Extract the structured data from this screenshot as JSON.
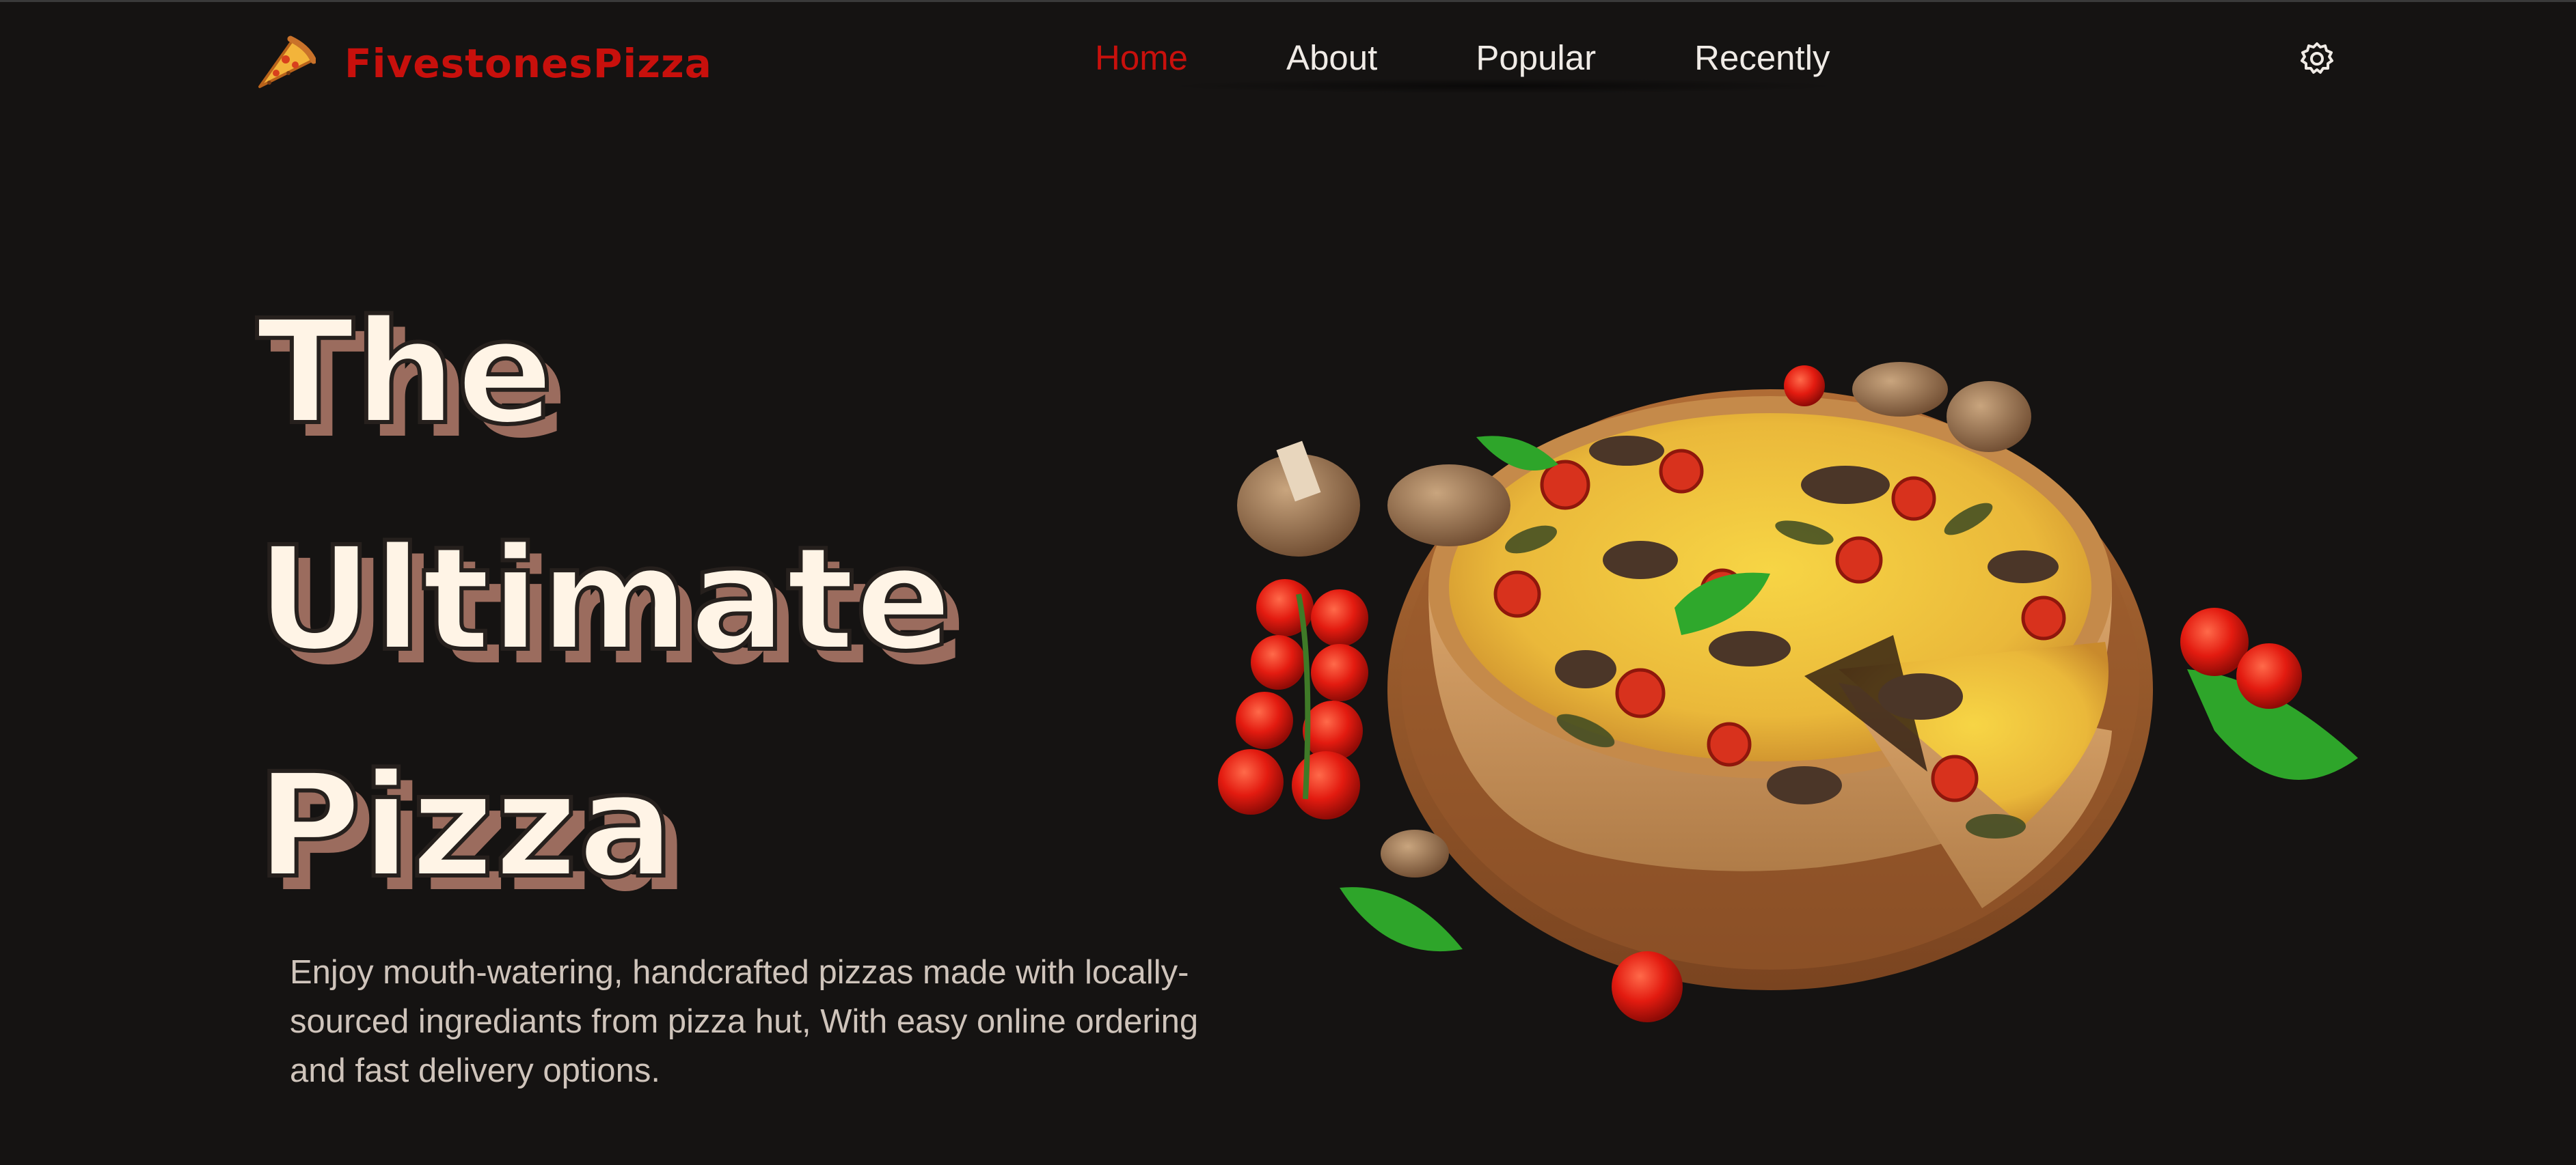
{
  "brand": {
    "name": "FivestonesPizza",
    "logo_icon": "pizza-slice-icon",
    "color": "#c8100c"
  },
  "nav": {
    "items": [
      {
        "label": "Home",
        "active": true
      },
      {
        "label": "About",
        "active": false
      },
      {
        "label": "Popular",
        "active": false
      },
      {
        "label": "Recently",
        "active": false
      }
    ],
    "active_color": "#c8100c",
    "text_color": "#f0ebe6"
  },
  "header": {
    "settings_icon": "gear-icon"
  },
  "hero": {
    "title_lines": [
      "The",
      "Ultimate",
      "Pizza"
    ],
    "description": "Enjoy mouth-watering, handcrafted pizzas made with locally-sourced ingrediants from pizza hut, With easy online ordering and fast delivery options.",
    "image_icon": "quiche-pizza-image",
    "title_color": "#fff4e6",
    "title_shadow_color": "#9b6c5e"
  },
  "colors": {
    "background": "#151312",
    "accent": "#c8100c"
  }
}
